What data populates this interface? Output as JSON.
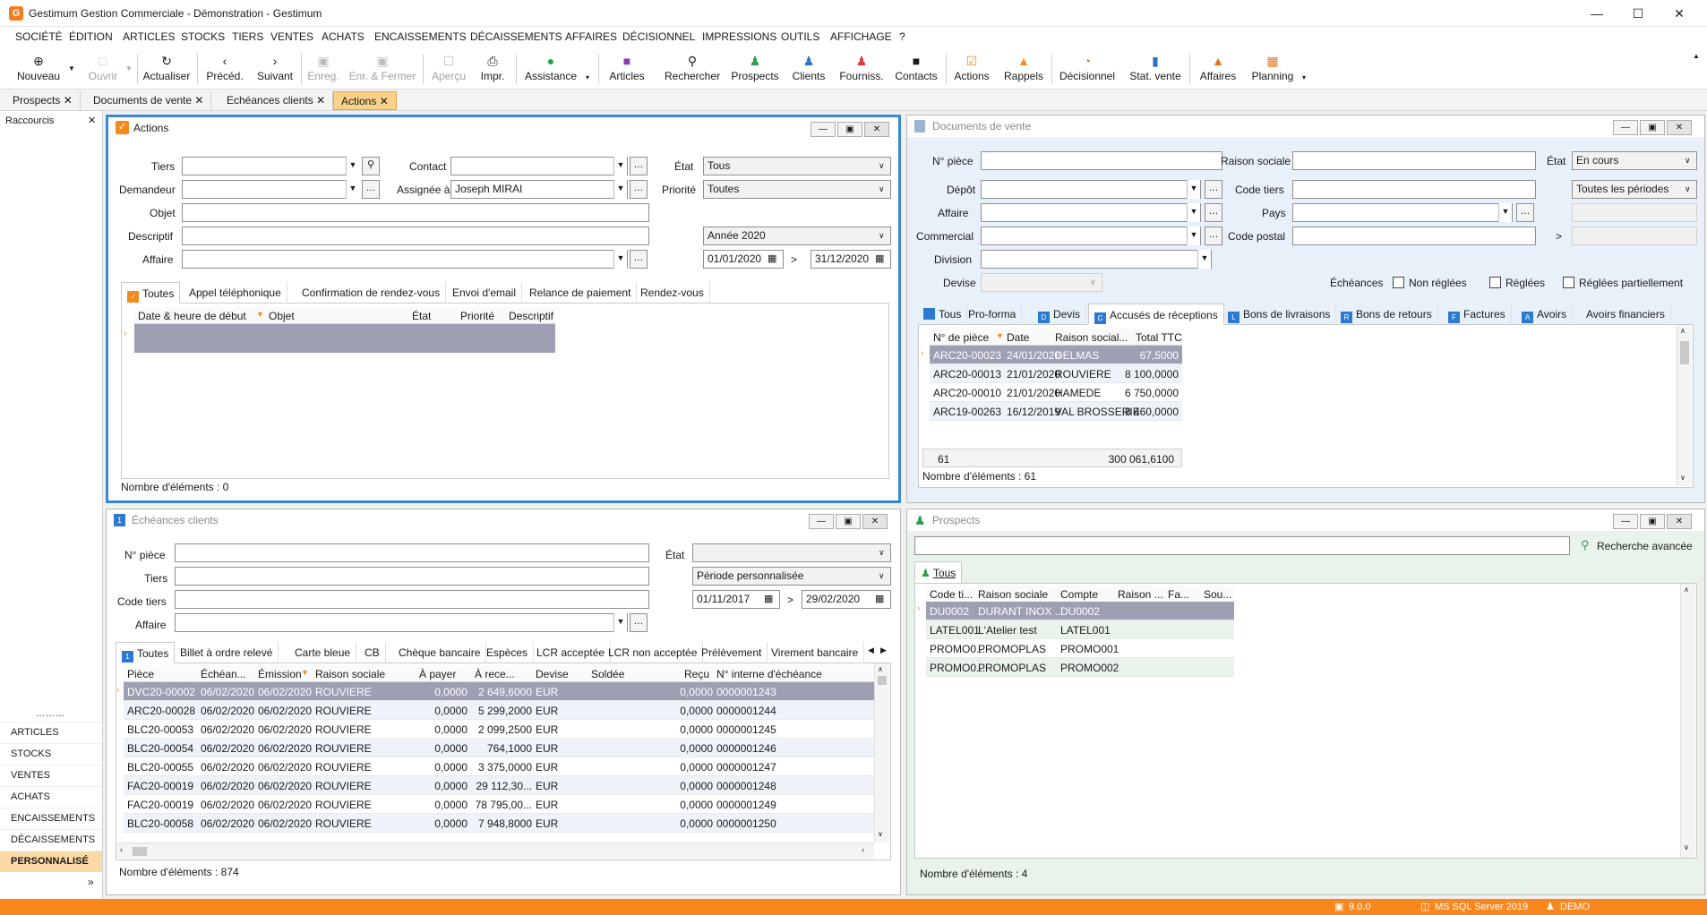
{
  "window": {
    "title": "Gestimum Gestion Commerciale - Démonstration - Gestimum"
  },
  "menu": [
    "SOCIÉTÉ",
    "ÉDITION",
    "ARTICLES",
    "STOCKS",
    "TIERS",
    "VENTES",
    "ACHATS",
    "ENCAISSEMENTS",
    "DÉCAISSEMENTS",
    "AFFAIRES",
    "DÉCISIONNEL",
    "IMPRESSIONS",
    "OUTILS",
    "AFFICHAGE",
    "?"
  ],
  "toolbar": {
    "nouveau": "Nouveau",
    "ouvrir": "Ouvrir",
    "actualiser": "Actualiser",
    "preced": "Précéd.",
    "suivant": "Suivant",
    "enreg": "Enreg.",
    "enr_fermer": "Enr. & Fermer",
    "apercu": "Aperçu",
    "impr": "Impr.",
    "assistance": "Assistance",
    "articles": "Articles",
    "rechercher": "Rechercher",
    "prospects": "Prospects",
    "clients": "Clients",
    "fourniss": "Fourniss.",
    "contacts": "Contacts",
    "actions": "Actions",
    "rappels": "Rappels",
    "decisionnel": "Décisionnel",
    "stat_vente": "Stat. vente",
    "affaires": "Affaires",
    "planning": "Planning"
  },
  "doc_tabs": [
    "Prospects",
    "Documents de vente",
    "Echéances clients",
    "Actions"
  ],
  "sidebar": {
    "title": "Raccourcis",
    "items": [
      "ARTICLES",
      "STOCKS",
      "VENTES",
      "ACHATS",
      "ENCAISSEMENTS",
      "DÉCAISSEMENTS",
      "PERSONNALISÉ"
    ]
  },
  "actions": {
    "title": "Actions",
    "labels": {
      "tiers": "Tiers",
      "demandeur": "Demandeur",
      "objet": "Objet",
      "descriptif": "Descriptif",
      "affaire": "Affaire",
      "contact": "Contact",
      "assigne": "Assignée à",
      "etat": "État",
      "priorite": "Priorité"
    },
    "assigne_value": "Joseph MIRAI",
    "etat_value": "Tous",
    "priorite_value": "Toutes",
    "periode": "Année 2020",
    "date_from": "01/01/2020",
    "date_to": "31/12/2020",
    "date_sep": ">",
    "tabs": [
      "Toutes",
      "Appel téléphonique",
      "Confirmation de rendez-vous",
      "Envoi d'email",
      "Relance de paiement",
      "Rendez-vous"
    ],
    "columns": [
      "Date & heure de début",
      "Objet",
      "État",
      "Priorité",
      "Descriptif"
    ],
    "count": "Nombre d'éléments : 0"
  },
  "docs_vente": {
    "title": "Documents de vente",
    "labels": {
      "npiece": "N° pièce",
      "depot": "Dépôt",
      "affaire": "Affaire",
      "commercial": "Commercial",
      "division": "Division",
      "devise": "Devise",
      "raison": "Raison sociale",
      "code_tiers": "Code tiers",
      "pays": "Pays",
      "code_postal": "Code postal",
      "etat": "État",
      "echeances": "Échéances",
      "non_reglees": "Non réglées",
      "reglees": "Réglées",
      "reglees_part": "Réglées partiellement"
    },
    "etat_value": "En cours",
    "periode": "Toutes les périodes",
    "range_sep": ">",
    "tabs": [
      "Tous",
      "Pro-forma",
      "Devis",
      "Accusés de réceptions",
      "Bons de livraisons",
      "Bons de retours",
      "Factures",
      "Avoirs",
      "Avoirs financiers"
    ],
    "columns": [
      "N° de pièce",
      "Date",
      "Raison social...",
      "Total TTC"
    ],
    "rows": [
      [
        "ARC20-00023",
        "24/01/2020",
        "DELMAS",
        "67,5000"
      ],
      [
        "ARC20-00013",
        "21/01/2020",
        "ROUVIERE",
        "8 100,0000"
      ],
      [
        "ARC20-00010",
        "21/01/2020",
        "HAMEDE",
        "6 750,0000"
      ],
      [
        "ARC19-00263",
        "16/12/2019",
        "VAL BROSSERIE",
        "8 460,0000"
      ]
    ],
    "footer_count": "61",
    "footer_total": "300 061,6100",
    "count": "Nombre d'éléments : 61"
  },
  "echeances": {
    "title": "Échéances clients",
    "labels": {
      "npiece": "N° pièce",
      "tiers": "Tiers",
      "code_tiers": "Code tiers",
      "affaire": "Affaire",
      "etat": "État"
    },
    "periode": "Période personnalisée",
    "date_from": "01/11/2017",
    "date_to": "29/02/2020",
    "date_sep": ">",
    "tabs": [
      "Toutes",
      "Billet à ordre relevé",
      "Carte bleue",
      "CB",
      "Chèque bancaire",
      "Espèces",
      "LCR acceptée",
      "LCR non acceptée",
      "Prélèvement",
      "Virement bancaire"
    ],
    "columns": [
      "Pièce",
      "Échéan...",
      "Émission",
      "Raison sociale",
      "À payer",
      "À rece...",
      "Devise",
      "Soldée",
      "Reçu",
      "N° interne d'échéance"
    ],
    "rows": [
      [
        "DVC20-00002",
        "06/02/2020",
        "06/02/2020",
        "ROUVIERE",
        "0,0000",
        "2 649,6000",
        "EUR",
        "",
        "0,0000",
        "0000001243"
      ],
      [
        "ARC20-00028",
        "06/02/2020",
        "06/02/2020",
        "ROUVIERE",
        "0,0000",
        "5 299,2000",
        "EUR",
        "",
        "0,0000",
        "0000001244"
      ],
      [
        "BLC20-00053",
        "06/02/2020",
        "06/02/2020",
        "ROUVIERE",
        "0,0000",
        "2 099,2500",
        "EUR",
        "",
        "0,0000",
        "0000001245"
      ],
      [
        "BLC20-00054",
        "06/02/2020",
        "06/02/2020",
        "ROUVIERE",
        "0,0000",
        "764,1000",
        "EUR",
        "",
        "0,0000",
        "0000001246"
      ],
      [
        "BLC20-00055",
        "06/02/2020",
        "06/02/2020",
        "ROUVIERE",
        "0,0000",
        "3 375,0000",
        "EUR",
        "",
        "0,0000",
        "0000001247"
      ],
      [
        "FAC20-00019",
        "06/02/2020",
        "06/02/2020",
        "ROUVIERE",
        "0,0000",
        "29 112,30...",
        "EUR",
        "",
        "0,0000",
        "0000001248"
      ],
      [
        "FAC20-00019",
        "06/02/2020",
        "06/02/2020",
        "ROUVIERE",
        "0,0000",
        "78 795,00...",
        "EUR",
        "",
        "0,0000",
        "0000001249"
      ],
      [
        "BLC20-00058",
        "06/02/2020",
        "06/02/2020",
        "ROUVIERE",
        "0,0000",
        "7 948,8000",
        "EUR",
        "",
        "0,0000",
        "0000001250"
      ]
    ],
    "count": "Nombre d'éléments : 874"
  },
  "prospects": {
    "title": "Prospects",
    "advanced": "Recherche avancée",
    "tab": "Tous",
    "columns": [
      "Code ti...",
      "Raison sociale",
      "Compte",
      "Raison ...",
      "Fa...",
      "Sou..."
    ],
    "rows": [
      [
        "DU0002",
        "DURANT INOX ...",
        "DU0002"
      ],
      [
        "LATEL001",
        "L'Atelier test",
        "LATEL001"
      ],
      [
        "PROMO0...",
        "PROMOPLAS",
        "PROMO001"
      ],
      [
        "PROMO0...",
        "PROMOPLAS",
        "PROMO002"
      ]
    ],
    "count": "Nombre d'éléments : 4"
  },
  "statusbar": {
    "version": "9.0.0",
    "db": "MS SQL Server 2019",
    "user": "DEMO"
  },
  "colors": {
    "accent": "#f8881e",
    "active_border": "#3a87d6",
    "selected_row": "#9e9fb3"
  }
}
